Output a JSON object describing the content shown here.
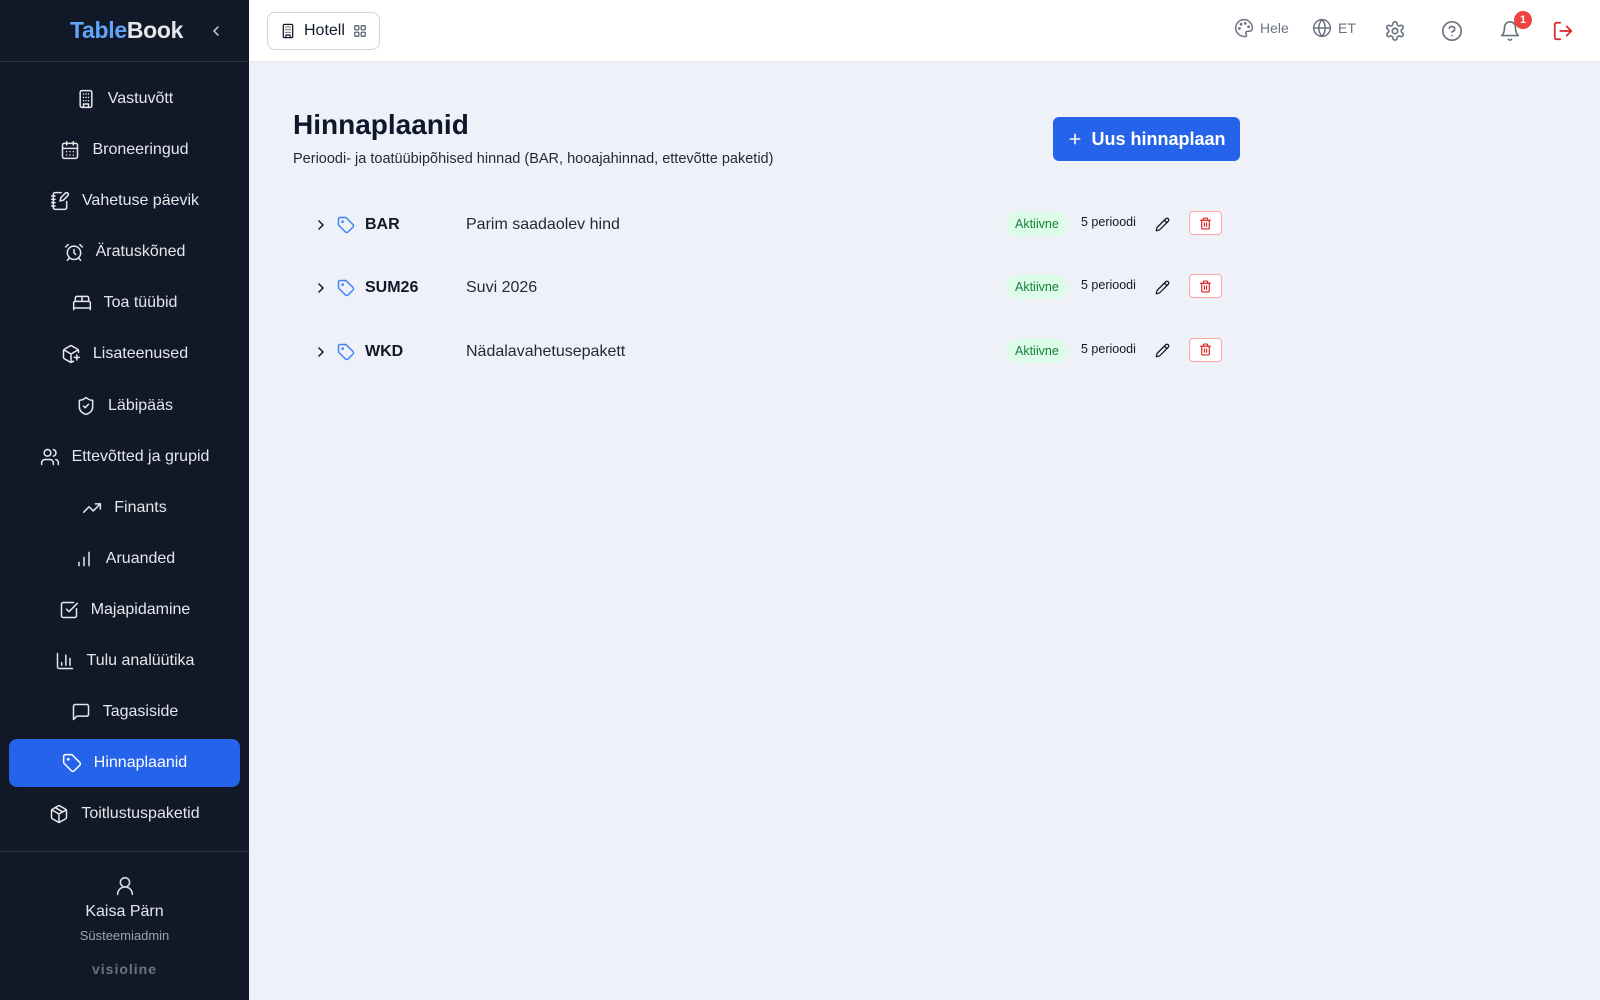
{
  "app": {
    "logo_part1": "Table",
    "logo_part2": "Book"
  },
  "sidebar": {
    "items": [
      {
        "label": "Vastuvõtt",
        "icon": "building-icon"
      },
      {
        "label": "Broneeringud",
        "icon": "calendar-icon"
      },
      {
        "label": "Vahetuse päevik",
        "icon": "notebook-pen-icon"
      },
      {
        "label": "Äratuskõned",
        "icon": "alarm-clock-icon"
      },
      {
        "label": "Toa tüübid",
        "icon": "bed-icon"
      },
      {
        "label": "Lisateenused",
        "icon": "package-plus-icon"
      },
      {
        "label": "Läbipääs",
        "icon": "shield-check-icon"
      },
      {
        "label": "Ettevõtted ja grupid",
        "icon": "users-icon"
      },
      {
        "label": "Finants",
        "icon": "trending-up-icon"
      },
      {
        "label": "Aruanded",
        "icon": "bar-chart-icon"
      },
      {
        "label": "Majapidamine",
        "icon": "check-square-icon"
      },
      {
        "label": "Tulu analüütika",
        "icon": "chart-column-icon"
      },
      {
        "label": "Tagasiside",
        "icon": "message-square-icon"
      },
      {
        "label": "Hinnaplaanid",
        "icon": "tag-icon",
        "active": true
      },
      {
        "label": "Toitlustuspaketid",
        "icon": "box-icon"
      }
    ],
    "user": {
      "name": "Kaisa Pärn",
      "role": "Süsteemiadmin"
    },
    "brand": "visioline"
  },
  "topbar": {
    "property": "Hotell",
    "theme_label": "Hele",
    "language": "ET",
    "notification_count": "1"
  },
  "main": {
    "title": "Hinnaplaanid",
    "subtitle": "Perioodi- ja toatüübipõhised hinnad (BAR, hooajahinnad, ettevõtte paketid)",
    "new_button": "Uus hinnaplaan",
    "plans": [
      {
        "code": "BAR",
        "name": "Parim saadaolev hind",
        "status": "Aktiivne",
        "periods": "5 perioodi"
      },
      {
        "code": "SUM26",
        "name": "Suvi 2026",
        "status": "Aktiivne",
        "periods": "5 perioodi"
      },
      {
        "code": "WKD",
        "name": "Nädalavahetusepakett",
        "status": "Aktiivne",
        "periods": "5 perioodi"
      }
    ]
  },
  "colors": {
    "sidebar_bg": "#111827",
    "accent": "#2563eb",
    "status_green_bg": "#dcfce7",
    "status_green_text": "#15803d",
    "danger": "#dc2626"
  }
}
